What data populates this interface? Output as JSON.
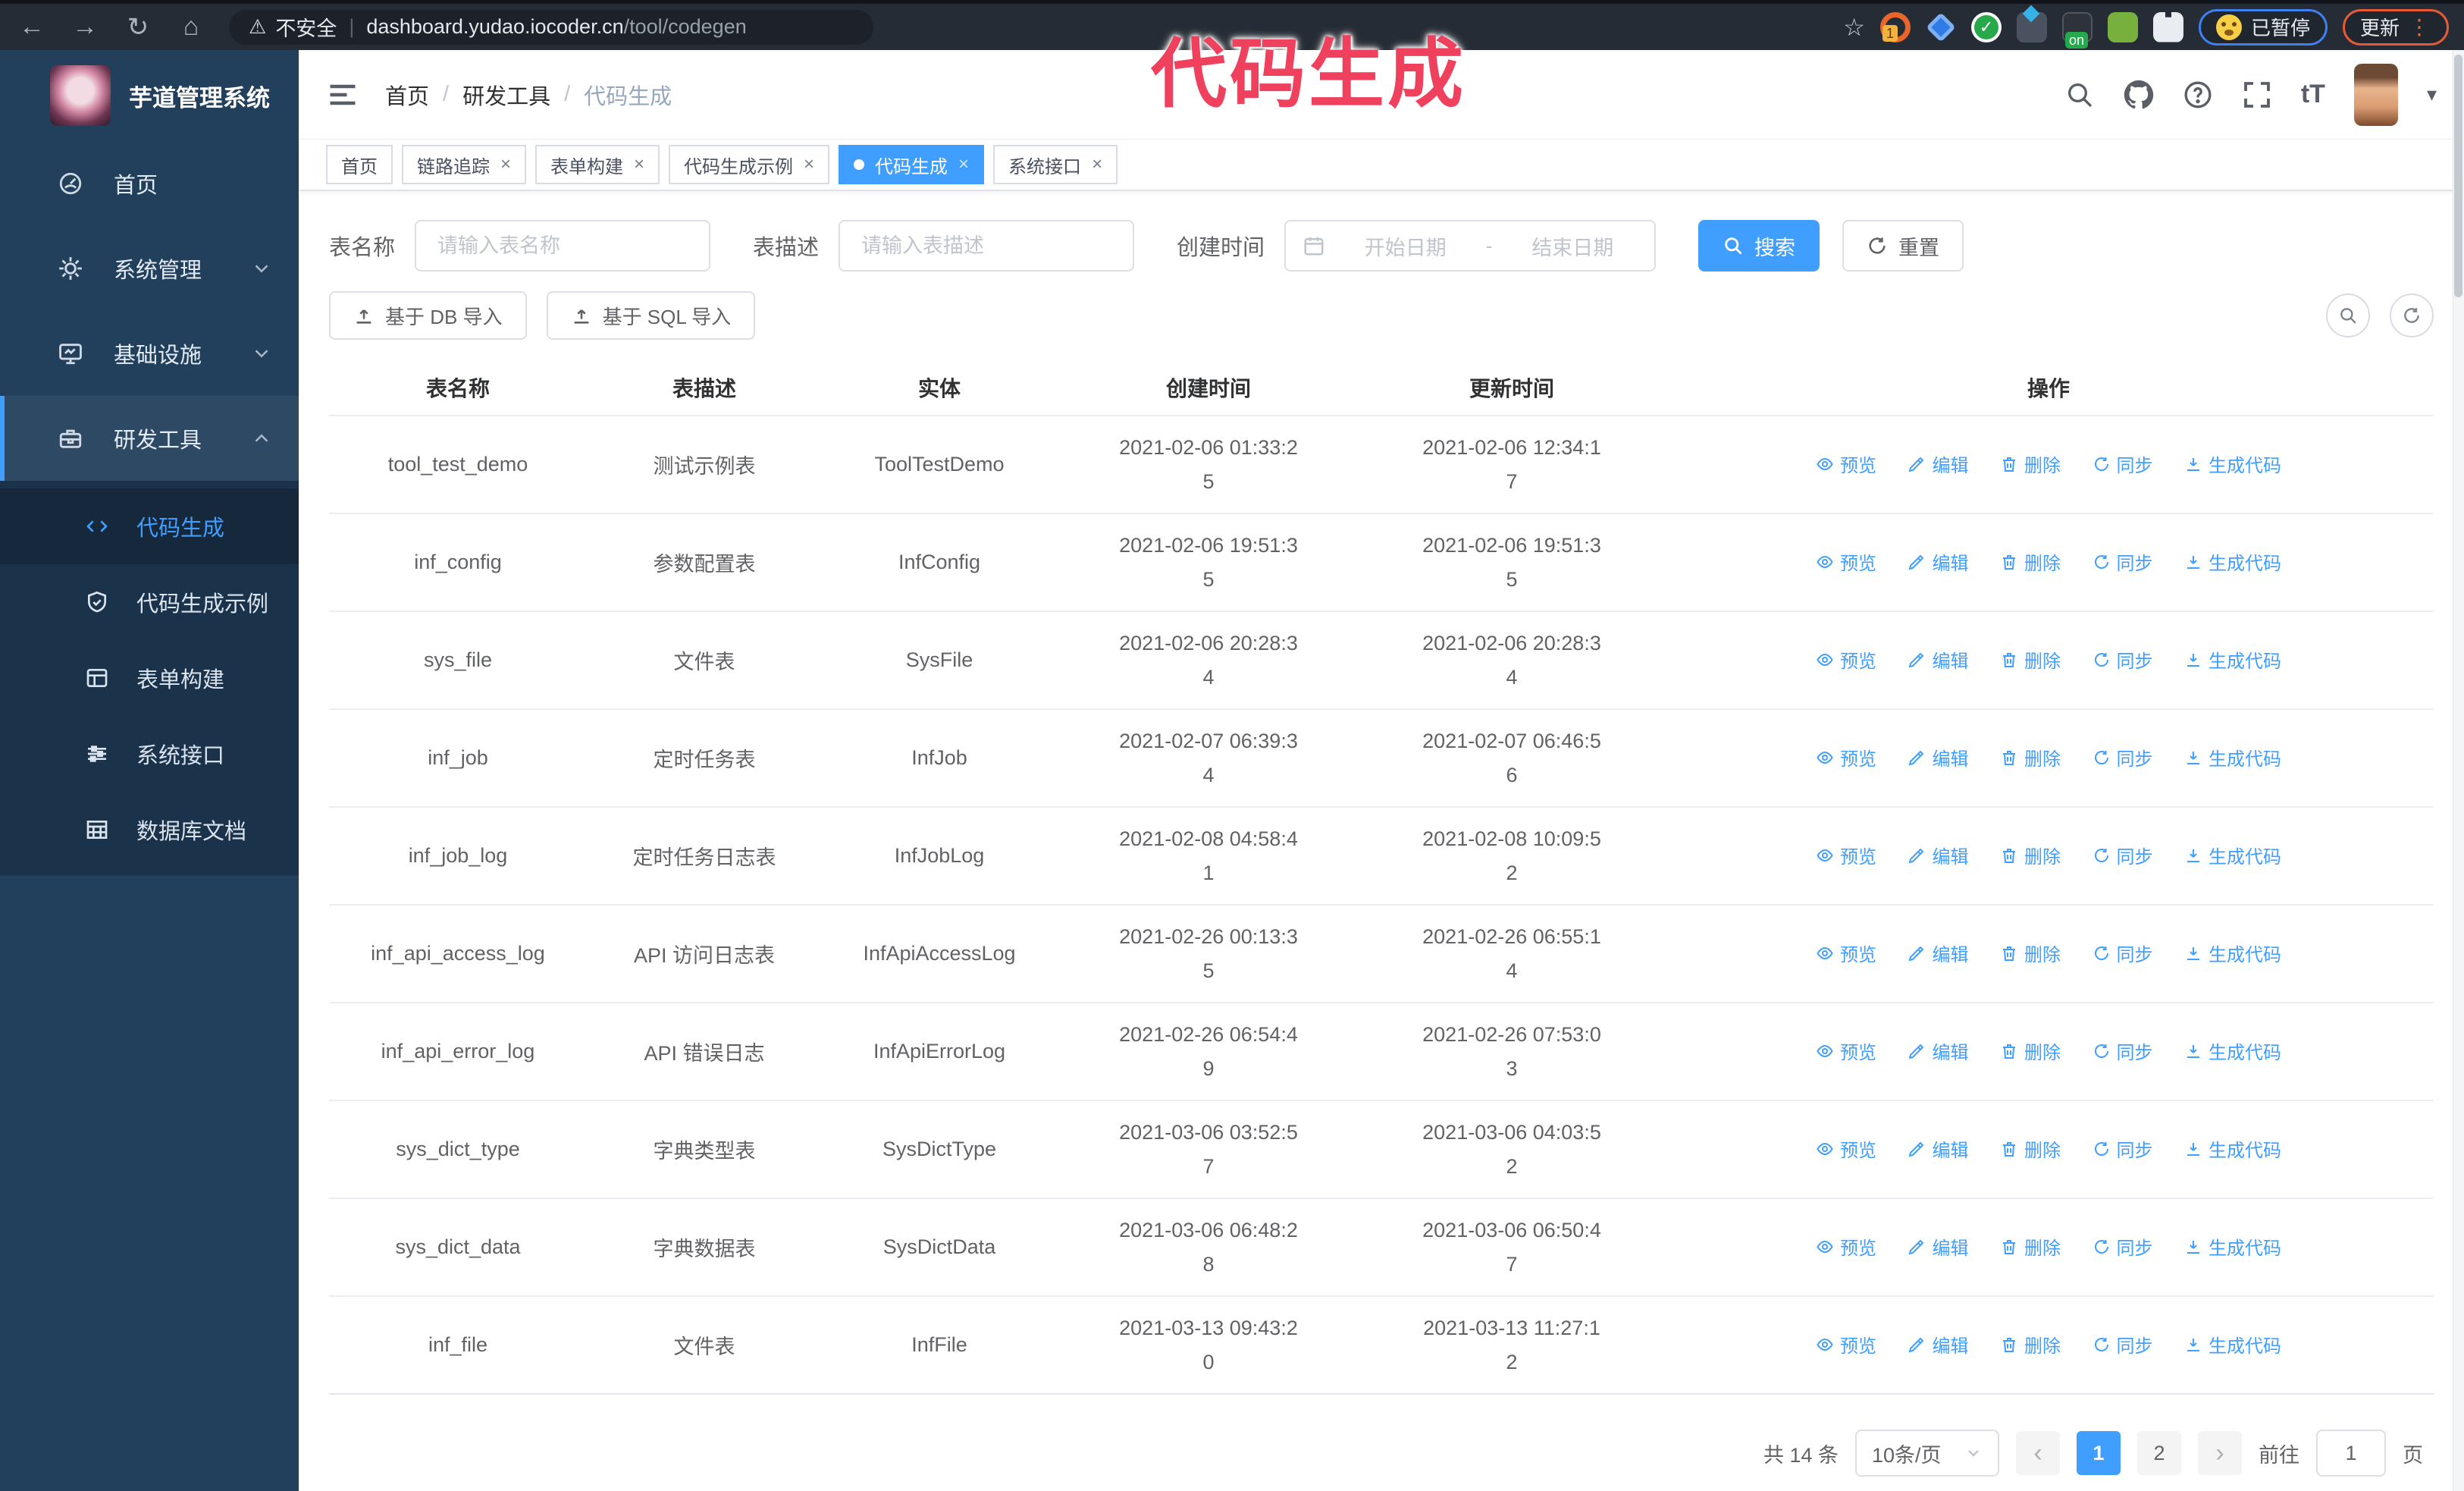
{
  "glyphs": {
    "back": "←",
    "forward": "→",
    "reload": "↻",
    "home": "⌂",
    "warning": "⚠",
    "divider": "|",
    "star": "☆",
    "close": "×",
    "slash": "/",
    "caret_down": "▾",
    "dots": "⋮",
    "check": "✓",
    "font_size": "tT"
  },
  "browser": {
    "security_label": "不安全",
    "url_host": "dashboard.yudao.iocoder.cn",
    "url_path": "/tool/codegen",
    "ext_badge_count": "1",
    "ext_badge_on": "on",
    "paused_label": "已暂停",
    "update_label": "更新"
  },
  "overlay": {
    "title": "代码生成",
    "color": "#ef415d"
  },
  "sidebar": {
    "app_title": "芋道管理系统",
    "items": [
      {
        "label": "首页"
      },
      {
        "label": "系统管理"
      },
      {
        "label": "基础设施"
      },
      {
        "label": "研发工具"
      }
    ],
    "subitems": [
      {
        "label": "代码生成"
      },
      {
        "label": "代码生成示例"
      },
      {
        "label": "表单构建"
      },
      {
        "label": "系统接口"
      },
      {
        "label": "数据库文档"
      }
    ]
  },
  "topbar": {
    "breadcrumb": [
      "首页",
      "研发工具",
      "代码生成"
    ]
  },
  "tags": [
    {
      "label": "首页"
    },
    {
      "label": "链路追踪"
    },
    {
      "label": "表单构建"
    },
    {
      "label": "代码生成示例"
    },
    {
      "label": "代码生成"
    },
    {
      "label": "系统接口"
    }
  ],
  "search": {
    "table_name_label": "表名称",
    "table_name_placeholder": "请输入表名称",
    "table_desc_label": "表描述",
    "table_desc_placeholder": "请输入表描述",
    "create_time_label": "创建时间",
    "start_placeholder": "开始日期",
    "range_separator": "-",
    "end_placeholder": "结束日期",
    "search_label": "搜索",
    "reset_label": "重置"
  },
  "toolbar": {
    "import_db_label": "基于 DB 导入",
    "import_sql_label": "基于 SQL 导入"
  },
  "table": {
    "columns": [
      "表名称",
      "表描述",
      "实体",
      "创建时间",
      "更新时间",
      "操作"
    ],
    "actions": [
      "预览",
      "编辑",
      "删除",
      "同步",
      "生成代码"
    ],
    "rows": [
      [
        "tool_test_demo",
        "测试示例表",
        "ToolTestDemo",
        "2021-02-06 01:33:25",
        "2021-02-06 12:34:17"
      ],
      [
        "inf_config",
        "参数配置表",
        "InfConfig",
        "2021-02-06 19:51:35",
        "2021-02-06 19:51:35"
      ],
      [
        "sys_file",
        "文件表",
        "SysFile",
        "2021-02-06 20:28:34",
        "2021-02-06 20:28:34"
      ],
      [
        "inf_job",
        "定时任务表",
        "InfJob",
        "2021-02-07 06:39:34",
        "2021-02-07 06:46:56"
      ],
      [
        "inf_job_log",
        "定时任务日志表",
        "InfJobLog",
        "2021-02-08 04:58:41",
        "2021-02-08 10:09:52"
      ],
      [
        "inf_api_access_log",
        "API 访问日志表",
        "InfApiAccessLog",
        "2021-02-26 00:13:35",
        "2021-02-26 06:55:14"
      ],
      [
        "inf_api_error_log",
        "API 错误日志",
        "InfApiErrorLog",
        "2021-02-26 06:54:49",
        "2021-02-26 07:53:03"
      ],
      [
        "sys_dict_type",
        "字典类型表",
        "SysDictType",
        "2021-03-06 03:52:57",
        "2021-03-06 04:03:52"
      ],
      [
        "sys_dict_data",
        "字典数据表",
        "SysDictData",
        "2021-03-06 06:48:28",
        "2021-03-06 06:50:47"
      ],
      [
        "inf_file",
        "文件表",
        "InfFile",
        "2021-03-13 09:43:20",
        "2021-03-13 11:27:12"
      ]
    ]
  },
  "pagination": {
    "total": "共 14 条",
    "page_size": "10条/页",
    "prev": "‹",
    "pages": [
      "1",
      "2"
    ],
    "next": "›",
    "goto_label": "前往",
    "goto_value": "1",
    "unit_label": "页"
  }
}
